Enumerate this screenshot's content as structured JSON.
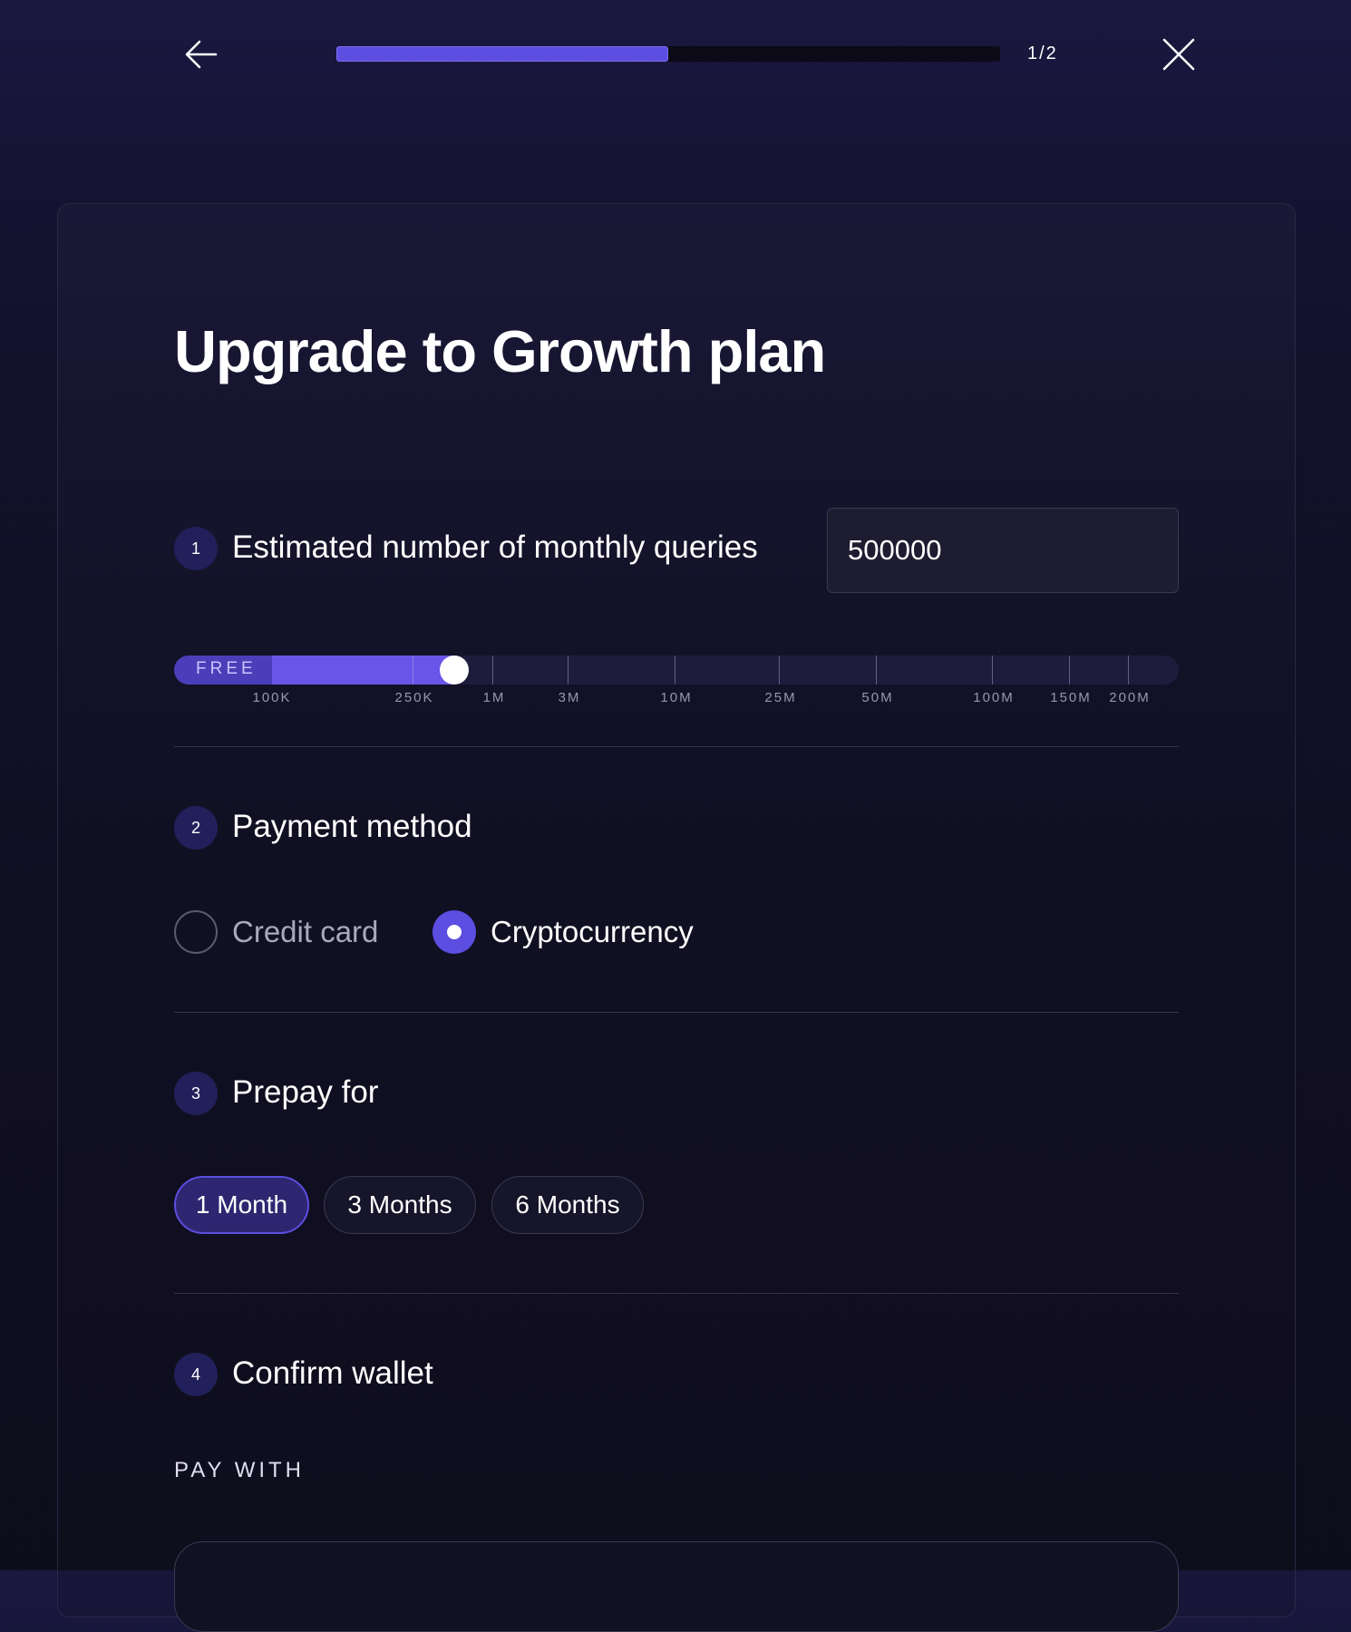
{
  "header": {
    "step_count": "1/2",
    "progress": 0.5
  },
  "title": "Upgrade to Growth plan",
  "steps": {
    "queries": {
      "number": "1",
      "title": "Estimated number of monthly queries",
      "input_value": "500000"
    },
    "payment": {
      "number": "2",
      "title": "Payment method",
      "options": [
        {
          "label": "Credit card",
          "selected": false
        },
        {
          "label": "Cryptocurrency",
          "selected": true
        }
      ]
    },
    "prepay": {
      "number": "3",
      "title": "Prepay for",
      "options": [
        {
          "label": "1 Month",
          "selected": true
        },
        {
          "label": "3 Months",
          "selected": false
        },
        {
          "label": "6 Months",
          "selected": false
        }
      ]
    },
    "wallet": {
      "number": "4",
      "title": "Confirm wallet",
      "pay_with_label": "PAY WITH"
    }
  },
  "slider": {
    "free_label": "FREE",
    "ticks": [
      "100K",
      "250K",
      "1M",
      "3M",
      "10M",
      "25M",
      "50M",
      "100M",
      "150M",
      "200M"
    ],
    "value": "500000"
  },
  "colors": {
    "accent": "#5b4ee0",
    "slider_fill": "#6a55e8",
    "background": "#111025"
  }
}
